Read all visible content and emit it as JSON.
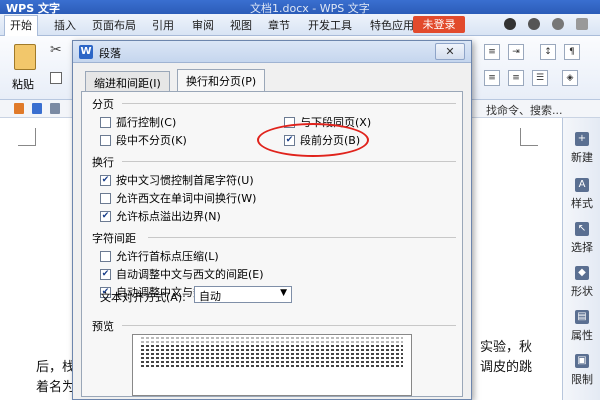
{
  "window": {
    "app_name": "WPS 文字",
    "doc_title": "文档1.docx - WPS 文字"
  },
  "ribbon": {
    "tabs": [
      "开始",
      "插入",
      "页面布局",
      "引用",
      "审阅",
      "视图",
      "章节",
      "开发工具",
      "特色应用"
    ],
    "login_label": "未登录"
  },
  "toolbar": {
    "paste_label": "粘贴"
  },
  "quickbar": {
    "search_hint": "找命令、搜索..."
  },
  "document": {
    "lines": [
      "实验，秋",
      "后，栈",
      "调皮的跳",
      "着名为"
    ]
  },
  "right_panel": {
    "items": [
      "新建",
      "样式",
      "选择",
      "形状",
      "属性",
      "限制"
    ]
  },
  "dialog": {
    "title": "段落",
    "close_label": "✕",
    "tabs": [
      "缩进和间距(I)",
      "换行和分页(P)"
    ],
    "sections": {
      "pagination": "分页",
      "line_break": "换行",
      "char_spacing": "字符间距",
      "preview": "预览"
    },
    "options": {
      "widow_control": {
        "label": "孤行控制(C)",
        "checked": false
      },
      "keep_with_next": {
        "label": "与下段同页(X)",
        "checked": false
      },
      "keep_lines": {
        "label": "段中不分页(K)",
        "checked": false
      },
      "page_break_before": {
        "label": "段前分页(B)",
        "checked": true
      },
      "kinsoku": {
        "label": "按中文习惯控制首尾字符(U)",
        "checked": true
      },
      "word_wrap": {
        "label": "允许西文在单词中间换行(W)",
        "checked": false
      },
      "hanging_punct": {
        "label": "允许标点溢出边界(N)",
        "checked": true
      },
      "compress_punct": {
        "label": "允许行首标点压缩(L)",
        "checked": false
      },
      "auto_space_latin": {
        "label": "自动调整中文与西文的间距(E)",
        "checked": true
      },
      "auto_space_num": {
        "label": "自动调整中文与数字的间距(S)",
        "checked": true
      }
    },
    "text_align": {
      "label": "文本对齐方式(A):",
      "value": "自动"
    }
  },
  "colors": {
    "accent": "#2b5cb8",
    "login": "#e24a2c",
    "highlight": "#e0231c"
  }
}
